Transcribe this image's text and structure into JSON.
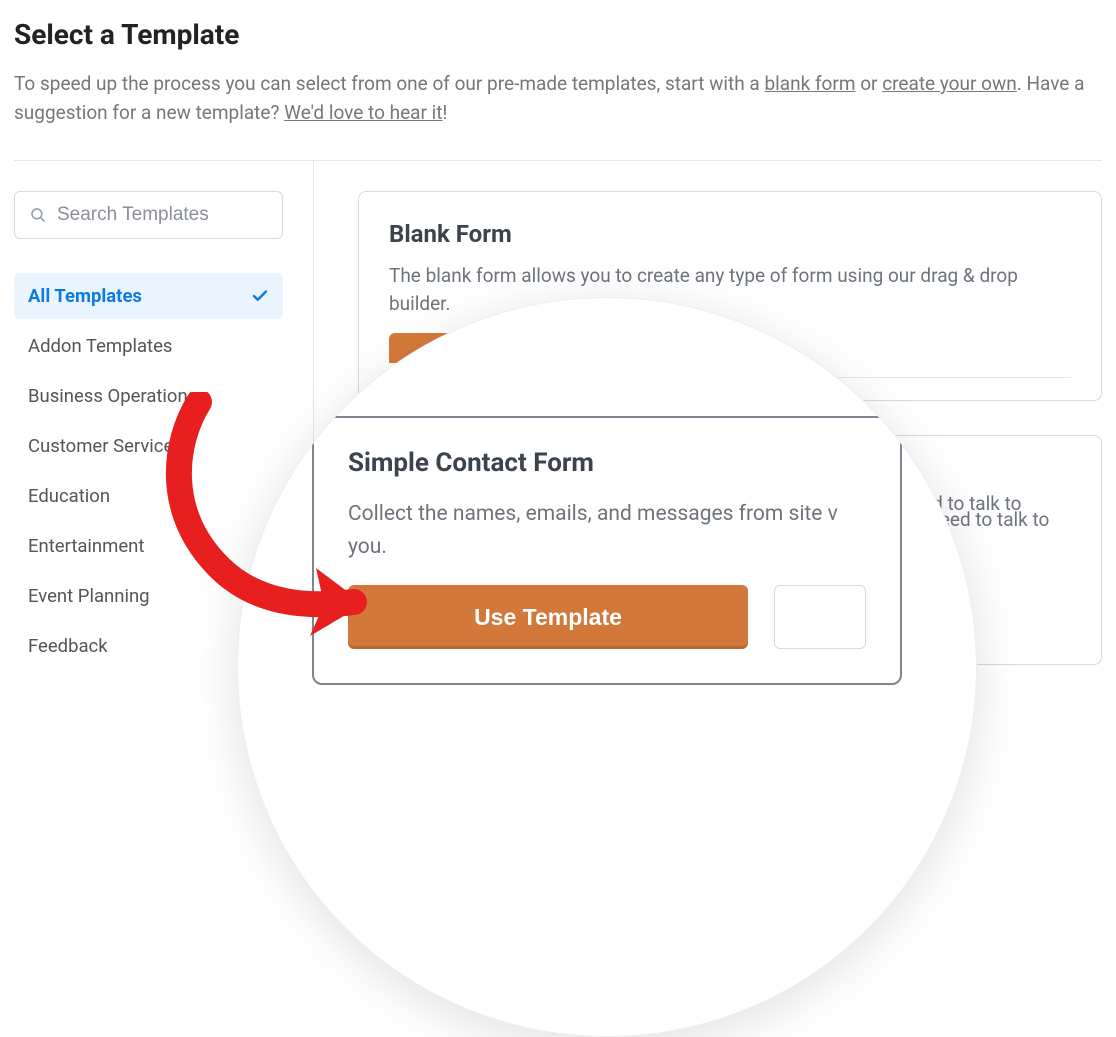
{
  "heading": "Select a Template",
  "intro": {
    "pre": "To speed up the process you can select from one of our pre-made templates, start with a ",
    "link1": "blank form",
    "mid": " or ",
    "link2": "create your own",
    "post": ". Have a suggestion for a new template? ",
    "link3": "We'd love to hear it",
    "bang": "!"
  },
  "search": {
    "placeholder": "Search Templates"
  },
  "categories": [
    {
      "label": "All Templates",
      "active": true
    },
    {
      "label": "Addon Templates",
      "active": false
    },
    {
      "label": "Business Operations",
      "active": false
    },
    {
      "label": "Customer Service",
      "active": false
    },
    {
      "label": "Education",
      "active": false
    },
    {
      "label": "Entertainment",
      "active": false
    },
    {
      "label": "Event Planning",
      "active": false
    },
    {
      "label": "Feedback",
      "active": false
    }
  ],
  "cards": {
    "blank": {
      "title": "Blank Form",
      "desc": "The blank form allows you to create any type of form using our drag & drop builder."
    },
    "simple": {
      "title": "Simple Contact Form",
      "desc_full": "Collect the names, emails, and messages from site visitors who need to talk to you.",
      "desc_zoom": "Collect the names, emails, and messages from site v you.",
      "behind_fragment": "ed to talk to",
      "use_label": "Use Template"
    }
  }
}
